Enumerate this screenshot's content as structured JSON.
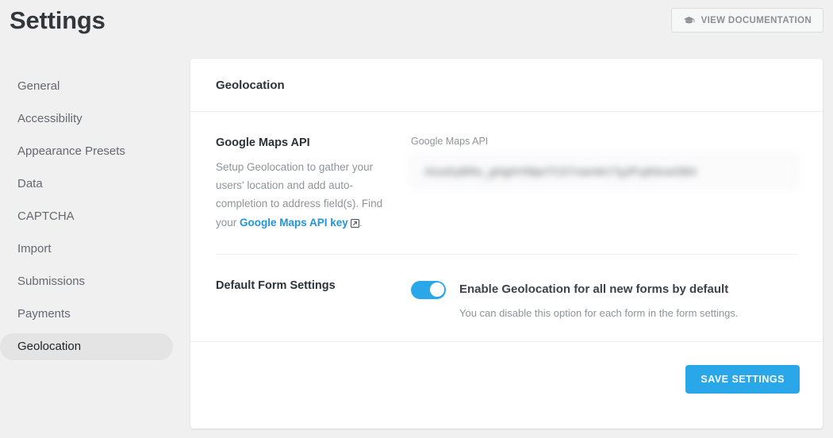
{
  "header": {
    "title": "Settings",
    "doc_button_label": "VIEW DOCUMENTATION",
    "doc_button_icon": "graduation-cap-icon"
  },
  "sidebar": {
    "items": [
      {
        "label": "General",
        "active": false
      },
      {
        "label": "Accessibility",
        "active": false
      },
      {
        "label": "Appearance Presets",
        "active": false
      },
      {
        "label": "Data",
        "active": false
      },
      {
        "label": "CAPTCHA",
        "active": false
      },
      {
        "label": "Import",
        "active": false
      },
      {
        "label": "Submissions",
        "active": false
      },
      {
        "label": "Payments",
        "active": false
      },
      {
        "label": "Geolocation",
        "active": true
      }
    ]
  },
  "panel": {
    "title": "Geolocation",
    "api_section": {
      "label_title": "Google Maps API",
      "desc_before_link": "Setup Geolocation to gather your users' location and add auto-completion to address field(s). Find your ",
      "link_text": "Google Maps API key",
      "link_icon": "external-link-icon",
      "desc_after_link": ".",
      "field_label": "Google Maps API",
      "field_value": "AIzaSyBRe_gHgHVMjwTCD7vwmkV7gJPujKbvwSB4",
      "field_placeholder": "Google Maps API"
    },
    "default_form_section": {
      "label_title": "Default Form Settings",
      "toggle_state": "on",
      "toggle_title": "Enable Geolocation for all new forms by default",
      "toggle_desc": "You can disable this option for each form in the form settings."
    },
    "footer": {
      "save_label": "SAVE SETTINGS"
    }
  },
  "colors": {
    "accent": "#29a7e8",
    "link": "#2196d6",
    "page_background": "#f0f0f1",
    "sidebar_active_background": "#e4e4e4"
  }
}
